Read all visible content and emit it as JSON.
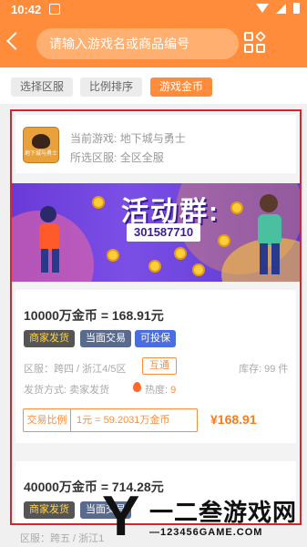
{
  "status_bar": {
    "time": "10:42"
  },
  "search": {
    "placeholder": "请输入游戏名或商品编号"
  },
  "filters": [
    {
      "label": "选择区服",
      "active": false
    },
    {
      "label": "比例排序",
      "active": false
    },
    {
      "label": "游戏金币",
      "active": true
    }
  ],
  "game": {
    "current_game_label": "当前游戏:",
    "current_game": "地下城与勇士",
    "server_label": "所选区服:",
    "server": "全区全服",
    "logo_text": "地下城与勇士"
  },
  "banner": {
    "title": "活动群:",
    "qq_number": "301587710"
  },
  "listings": [
    {
      "title": "10000万金币 = 168.91元",
      "tags": [
        "商家发货",
        "当面交易",
        "可投保"
      ],
      "region": "区服：跨四 / 浙江4/5区",
      "cross_tag": "互通",
      "stock": "库存: 99 件",
      "delivery": "发货方式: 卖家发货",
      "heat_label": "热度:",
      "heat_value": "9",
      "ratio_label": "交易比例",
      "ratio_value": "1元 = 59.2031万金币",
      "price": "¥168.91"
    },
    {
      "title": "40000万金币 = 714.28元",
      "tags": [
        "商家发货",
        "当面交易"
      ],
      "region": "区服：跨五 / 浙江1"
    }
  ],
  "watermark": {
    "glyph": "Y",
    "name": "一二叁游戏网",
    "domain": "—123456GAME.COM"
  },
  "colors": {
    "accent": "#ff8c3a",
    "highlight_border": "#d9242d",
    "price": "#ff7a1a"
  }
}
